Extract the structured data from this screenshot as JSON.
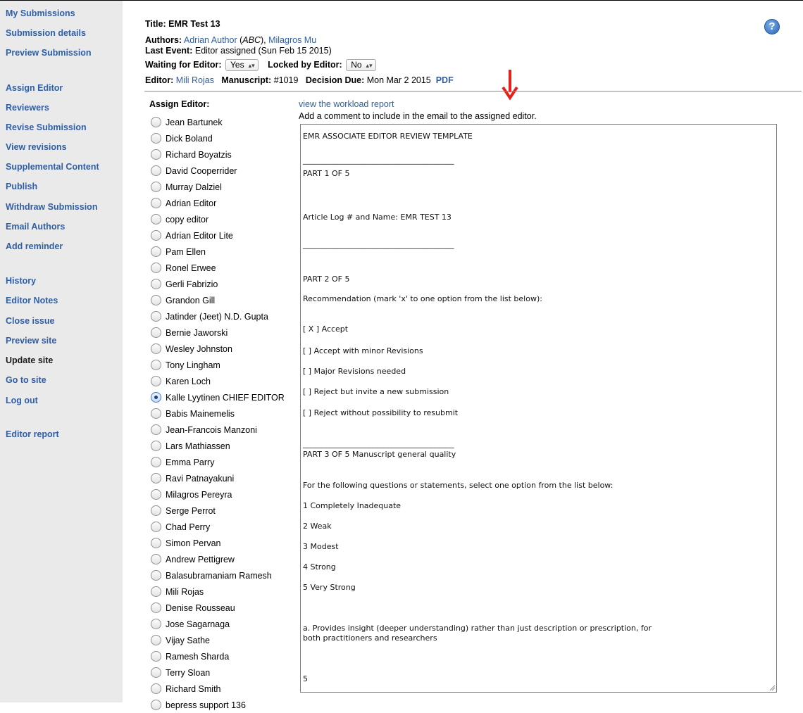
{
  "sidebar": {
    "items": [
      {
        "label": "My Submissions"
      },
      {
        "label": "Submission details"
      },
      {
        "label": "Preview Submission"
      },
      {
        "label": "Assign Editor"
      },
      {
        "label": "Reviewers"
      },
      {
        "label": "Revise Submission"
      },
      {
        "label": "View revisions"
      },
      {
        "label": "Supplemental Content"
      },
      {
        "label": "Publish"
      },
      {
        "label": "Withdraw Submission"
      },
      {
        "label": "Email Authors"
      },
      {
        "label": "Add reminder"
      },
      {
        "label": "History"
      },
      {
        "label": "Editor Notes"
      },
      {
        "label": "Close issue"
      },
      {
        "label": "Preview site"
      },
      {
        "label": "Update site"
      },
      {
        "label": "Go to site"
      },
      {
        "label": "Log out"
      },
      {
        "label": "Editor report"
      }
    ]
  },
  "header": {
    "title_label": "Title:",
    "title_value": "EMR Test 13",
    "authors_label": "Authors:",
    "author1": "Adrian Author",
    "author1_affil": "ABC",
    "author2": "Milagros Mu",
    "last_event_label": "Last Event:",
    "last_event_value": "Editor assigned (Sun Feb 15 2015)",
    "waiting_label": "Waiting for Editor:",
    "waiting_value": "Yes",
    "locked_label": "Locked by Editor:",
    "locked_value": "No",
    "editor_label": "Editor:",
    "editor_value": "Mili Rojas",
    "manuscript_label": "Manuscript:",
    "manuscript_value": "#1019",
    "decision_label": "Decision Due:",
    "decision_value": "Mon Mar 2 2015",
    "pdf_link": "PDF",
    "help_glyph": "?"
  },
  "assign": {
    "label": "Assign Editor:",
    "selected": "Kalle Lyytinen CHIEF EDITOR",
    "editors": [
      "Jean Bartunek",
      "Dick Boland",
      "Richard Boyatzis",
      "David Cooperrider",
      "Murray Dalziel",
      "Adrian Editor",
      "copy editor",
      "Adrian Editor Lite",
      "Pam Ellen",
      "Ronel Erwee",
      "Gerli Fabrizio",
      "Grandon Gill",
      "Jatinder (Jeet) N.D. Gupta",
      "Bernie Jaworski",
      "Wesley Johnston",
      "Tony Lingham",
      "Karen Loch",
      "Kalle Lyytinen CHIEF EDITOR",
      "Babis Mainemelis",
      "Jean-Francois Manzoni",
      "Lars Mathiassen",
      "Emma Parry",
      "Ravi Patnayakuni",
      "Milagros Pereyra",
      "Serge Perrot",
      "Chad Perry",
      "Simon Pervan",
      "Andrew Pettigrew",
      "Balasubramaniam Ramesh",
      "Mili Rojas",
      "Denise Rousseau",
      "Jose Sagarnaga",
      "Vijay Sathe",
      "Ramesh Sharda",
      "Terry Sloan",
      "Richard Smith",
      "bepress support 136"
    ]
  },
  "comment": {
    "workload_link": "view the workload report",
    "instruction": "Add a comment to include in the email to the assigned editor.",
    "lines": [
      "EMR ASSOCIATE EDITOR REVIEW TEMPLATE",
      "_______________________________________",
      "PART 1 OF 5",
      "Article Log # and Name:  EMR TEST 13",
      "_______________________________________",
      "PART 2 OF 5",
      "Recommendation (mark 'x' to one option from the list below):",
      "[ X  ] Accept",
      "[    ] Accept with minor Revisions",
      "[    ] Major Revisions needed",
      "[    ] Reject but invite a new submission",
      "[    ] Reject without possibility to resubmit",
      "_______________________________________",
      "PART 3 OF 5  Manuscript general quality",
      "For the following questions or statements, select one option from the list below:",
      "1 Completely Inadequate",
      "2 Weak",
      "3 Modest",
      "4 Strong",
      "5 Very Strong",
      "a. Provides insight (deeper understanding) rather than just description or prescription, for both practitioners and researchers",
      "5"
    ]
  }
}
